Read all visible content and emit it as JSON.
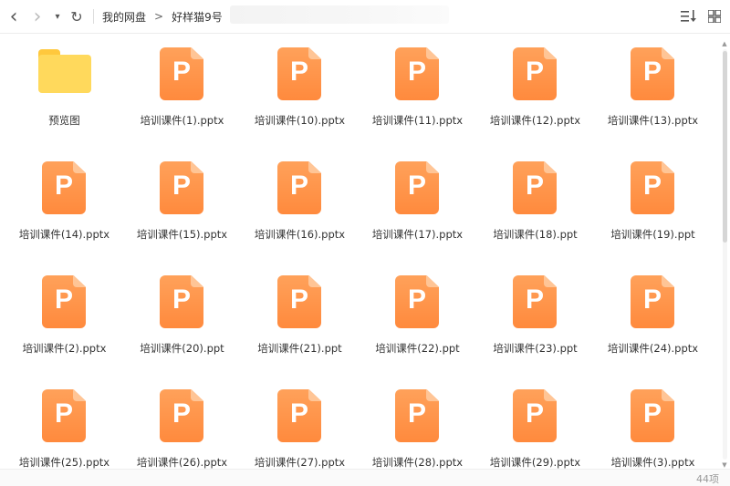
{
  "toolbar": {
    "back": "‹",
    "forward": "›",
    "dropdown": "▾",
    "refresh": "↻"
  },
  "breadcrumb": {
    "root": "我的网盘",
    "sep1": ">",
    "folder": "好样猫9号",
    "sep2": ">"
  },
  "sort_icon": "sort-icon",
  "files": [
    {
      "name": "预览图",
      "type": "folder"
    },
    {
      "name": "培训课件(1).pptx",
      "type": "ppt"
    },
    {
      "name": "培训课件(10).pptx",
      "type": "ppt"
    },
    {
      "name": "培训课件(11).pptx",
      "type": "ppt"
    },
    {
      "name": "培训课件(12).pptx",
      "type": "ppt"
    },
    {
      "name": "培训课件(13).pptx",
      "type": "ppt"
    },
    {
      "name": "培训课件(14).pptx",
      "type": "ppt"
    },
    {
      "name": "培训课件(15).pptx",
      "type": "ppt"
    },
    {
      "name": "培训课件(16).pptx",
      "type": "ppt"
    },
    {
      "name": "培训课件(17).pptx",
      "type": "ppt"
    },
    {
      "name": "培训课件(18).ppt",
      "type": "ppt"
    },
    {
      "name": "培训课件(19).ppt",
      "type": "ppt"
    },
    {
      "name": "培训课件(2).pptx",
      "type": "ppt"
    },
    {
      "name": "培训课件(20).ppt",
      "type": "ppt"
    },
    {
      "name": "培训课件(21).ppt",
      "type": "ppt"
    },
    {
      "name": "培训课件(22).ppt",
      "type": "ppt"
    },
    {
      "name": "培训课件(23).ppt",
      "type": "ppt"
    },
    {
      "name": "培训课件(24).pptx",
      "type": "ppt"
    },
    {
      "name": "培训课件(25).pptx",
      "type": "ppt"
    },
    {
      "name": "培训课件(26).pptx",
      "type": "ppt"
    },
    {
      "name": "培训课件(27).pptx",
      "type": "ppt"
    },
    {
      "name": "培训课件(28).pptx",
      "type": "ppt"
    },
    {
      "name": "培训课件(29).pptx",
      "type": "ppt"
    },
    {
      "name": "培训课件(3).pptx",
      "type": "ppt"
    }
  ],
  "ppt_glyph": "P",
  "status": {
    "count": "44项"
  },
  "colors": {
    "ppt": "#ff8a3d",
    "folder": "#ffd95c"
  }
}
